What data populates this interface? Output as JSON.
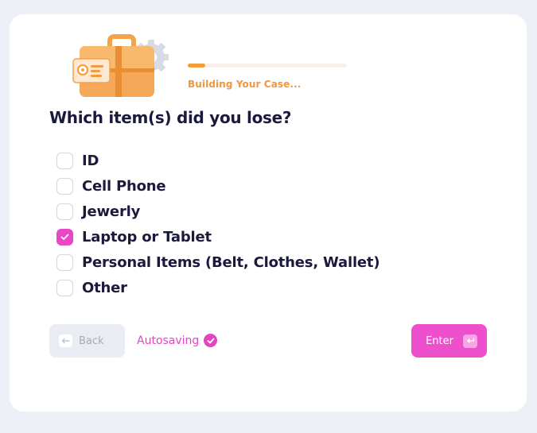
{
  "progress": {
    "label": "Building Your Case...",
    "fraction": 0.11
  },
  "question": "Which item(s) did you lose?",
  "options": [
    {
      "label": "ID",
      "checked": false
    },
    {
      "label": "Cell Phone",
      "checked": false
    },
    {
      "label": "Jewerly",
      "checked": false
    },
    {
      "label": "Laptop or Tablet",
      "checked": true
    },
    {
      "label": "Personal Items (Belt, Clothes, Wallet)",
      "checked": false
    },
    {
      "label": "Other",
      "checked": false
    }
  ],
  "footer": {
    "back_label": "Back",
    "autosave_label": "Autosaving",
    "enter_label": "Enter"
  },
  "icons": {
    "illustration": "briefcase-id-card-gear-icon",
    "back_key": "backspace-key-icon",
    "autosave": "check-circle-icon",
    "enter_key": "enter-key-icon",
    "checkbox_check": "check-icon"
  },
  "colors": {
    "accent_pink": "#ea47c6",
    "accent_orange": "#f49b3b",
    "text_dark": "#1b1a3c",
    "background": "#eef0f8"
  }
}
